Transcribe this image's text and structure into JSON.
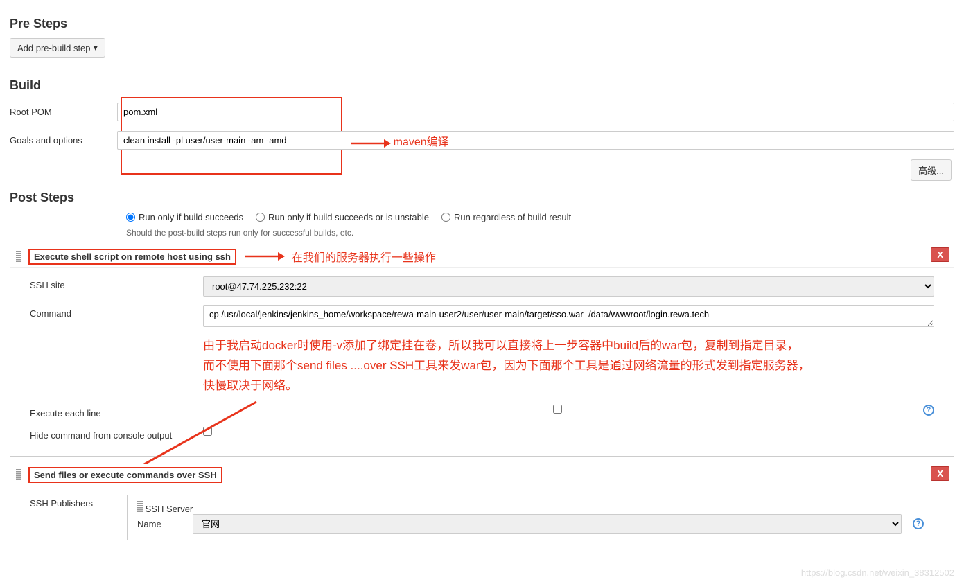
{
  "preSteps": {
    "title": "Pre Steps",
    "addButton": "Add pre-build step"
  },
  "build": {
    "title": "Build",
    "rootPomLabel": "Root POM",
    "rootPomValue": "pom.xml",
    "goalsLabel": "Goals and options",
    "goalsValue": "clean install -pl user/user-main -am -amd",
    "mavenNote": "maven编译",
    "advancedLabel": "高级..."
  },
  "postSteps": {
    "title": "Post Steps",
    "opt1": "Run only if build succeeds",
    "opt2": "Run only if build succeeds or is unstable",
    "opt3": "Run regardless of build result",
    "help": "Should the post-build steps run only for successful builds, etc.",
    "execShell": {
      "title": "Execute shell script on remote host using ssh",
      "note": "在我们的服务器执行一些操作",
      "sshSiteLabel": "SSH site",
      "sshSiteValue": "root@47.74.225.232:22",
      "commandLabel": "Command",
      "commandValue": "cp /usr/local/jenkins/jenkins_home/workspace/rewa-main-user2/user/user-main/target/sso.war  /data/wwwroot/login.rewa.tech",
      "note2a": "由于我启动docker时使用-v添加了绑定挂在卷，所以我可以直接将上一步容器中build后的war包，复制到指定目录，",
      "note2b": "而不使用下面那个send files ....over SSH工具来发war包，因为下面那个工具是通过网络流量的形式发到指定服务器，",
      "note2c": "快慢取决于网络。",
      "execEachLineLabel": "Execute each line",
      "hideCmdLabel": "Hide command from console output"
    },
    "sendFiles": {
      "title": "Send files or execute commands over SSH",
      "sshPublishersLabel": "SSH Publishers",
      "sshServerLabel": "SSH Server",
      "nameLabel": "Name",
      "nameValue": "官网"
    },
    "deleteX": "X"
  },
  "watermark": "https://blog.csdn.net/weixin_38312502"
}
